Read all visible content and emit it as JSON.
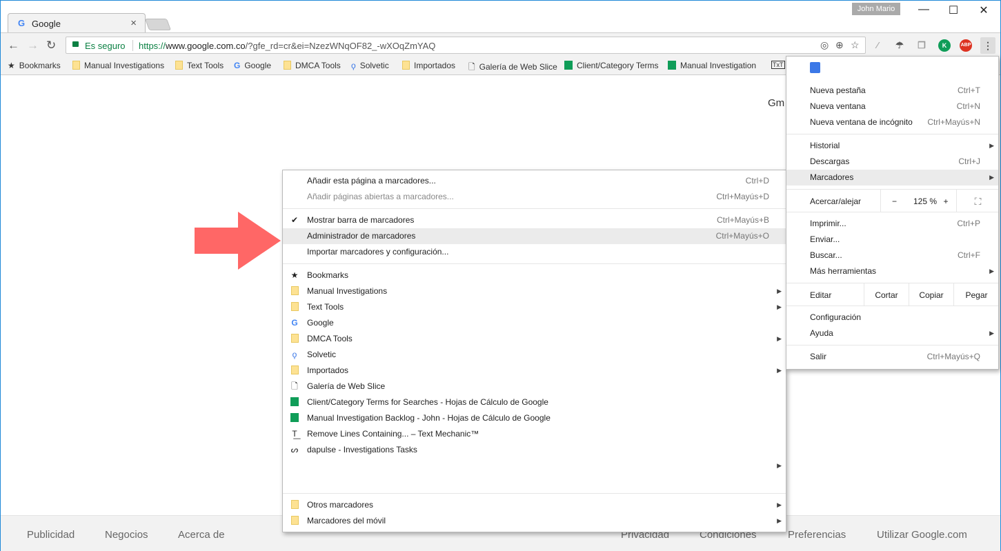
{
  "tab": {
    "title": "Google",
    "close": "×"
  },
  "window": {
    "user": "John Mario",
    "minimize": "—",
    "maximize": "☐",
    "close": "✕"
  },
  "omnibox": {
    "secure_label": "Es seguro",
    "url_scheme": "https://",
    "url_host": "www.google.com.co",
    "url_path": "/?gfe_rd=cr&ei=NzezWNqOF82_-wXOqZmYAQ"
  },
  "extensions": {
    "abp": "ABP",
    "k": "K"
  },
  "bookmarks_bar": [
    {
      "label": "Bookmarks",
      "icon": "star"
    },
    {
      "label": "Manual Investigations",
      "icon": "folder"
    },
    {
      "label": "Text Tools",
      "icon": "folder"
    },
    {
      "label": "Google",
      "icon": "google"
    },
    {
      "label": "DMCA Tools",
      "icon": "folder"
    },
    {
      "label": "Solvetic",
      "icon": "solvetic"
    },
    {
      "label": "Importados",
      "icon": "folder"
    },
    {
      "label": "Galería de Web Slice",
      "icon": "page"
    },
    {
      "label": "Client/Category Terms",
      "icon": "sheet"
    },
    {
      "label": "Manual Investigation",
      "icon": "sheet"
    }
  ],
  "page": {
    "gmail": "Gm"
  },
  "footer": {
    "left": [
      "Publicidad",
      "Negocios",
      "Acerca de"
    ],
    "right": [
      "Privacidad",
      "Condiciones",
      "Preferencias",
      "Utilizar Google.com"
    ]
  },
  "bookmarks_menu": [
    {
      "label": "Añadir esta página a marcadores...",
      "shortcut": "Ctrl+D"
    },
    {
      "label": "Añadir páginas abiertas a marcadores...",
      "shortcut": "Ctrl+Mayús+D",
      "disabled": true
    },
    {
      "sep": true
    },
    {
      "label": "Mostrar barra de marcadores",
      "shortcut": "Ctrl+Mayús+B",
      "icon": "check"
    },
    {
      "label": "Administrador de marcadores",
      "shortcut": "Ctrl+Mayús+O",
      "highlight": true
    },
    {
      "label": "Importar marcadores y configuración..."
    },
    {
      "sep": true
    },
    {
      "label": "Bookmarks",
      "icon": "star"
    },
    {
      "label": "Manual Investigations",
      "icon": "folder",
      "submenu": true
    },
    {
      "label": "Text Tools",
      "icon": "folder",
      "submenu": true
    },
    {
      "label": "Google",
      "icon": "google"
    },
    {
      "label": "DMCA Tools",
      "icon": "folder",
      "submenu": true
    },
    {
      "label": "Solvetic",
      "icon": "solvetic"
    },
    {
      "label": "Importados",
      "icon": "folder",
      "submenu": true
    },
    {
      "label": "Galería de Web Slice",
      "icon": "page"
    },
    {
      "label": "Client/Category Terms for Searches - Hojas de Cálculo de Google",
      "icon": "sheet"
    },
    {
      "label": "Manual Investigation Backlog - John - Hojas de Cálculo de Google",
      "icon": "sheet"
    },
    {
      "label": "Remove Lines Containing... – Text Mechanic™",
      "icon": "txt"
    },
    {
      "label": "dapulse - Investigations Tasks",
      "icon": "dapulse"
    },
    {
      "label": "",
      "submenu": true
    },
    {
      "spacer": true
    },
    {
      "sep": true
    },
    {
      "label": "Otros marcadores",
      "icon": "folder",
      "submenu": true
    },
    {
      "label": "Marcadores del móvil",
      "icon": "folder",
      "submenu": true
    }
  ],
  "chrome_menu": {
    "group1": [
      {
        "label": "Nueva pestaña",
        "shortcut": "Ctrl+T"
      },
      {
        "label": "Nueva ventana",
        "shortcut": "Ctrl+N"
      },
      {
        "label": "Nueva ventana de incógnito",
        "shortcut": "Ctrl+Mayús+N"
      }
    ],
    "group2": [
      {
        "label": "Historial",
        "submenu": true
      },
      {
        "label": "Descargas",
        "shortcut": "Ctrl+J"
      },
      {
        "label": "Marcadores",
        "submenu": true,
        "highlight": true
      }
    ],
    "zoom": {
      "label": "Acercar/alejar",
      "minus": "−",
      "value": "125 %",
      "plus": "+"
    },
    "group3": [
      {
        "label": "Imprimir...",
        "shortcut": "Ctrl+P"
      },
      {
        "label": "Enviar..."
      },
      {
        "label": "Buscar...",
        "shortcut": "Ctrl+F"
      },
      {
        "label": "Más herramientas",
        "submenu": true
      }
    ],
    "edit": {
      "label": "Editar",
      "cut": "Cortar",
      "copy": "Copiar",
      "paste": "Pegar"
    },
    "group4": [
      {
        "label": "Configuración"
      },
      {
        "label": "Ayuda",
        "submenu": true
      }
    ],
    "group5": [
      {
        "label": "Salir",
        "shortcut": "Ctrl+Mayús+Q"
      }
    ]
  },
  "colors": {
    "arrow": "#ff6766",
    "accent_green": "#0b8043",
    "folder": "#fde293"
  }
}
